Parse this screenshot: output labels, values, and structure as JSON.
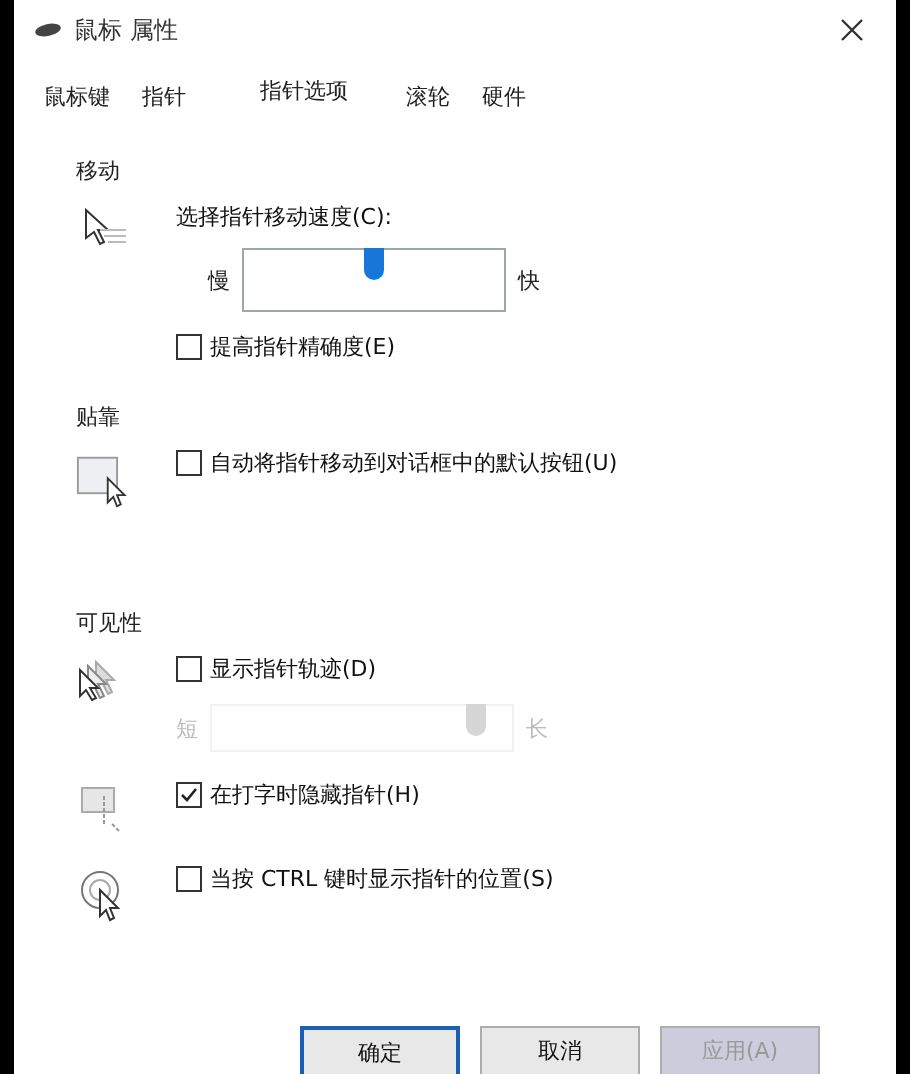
{
  "window": {
    "title": "鼠标 属性"
  },
  "tabs": [
    {
      "label": "鼠标键",
      "selected": false
    },
    {
      "label": "指针",
      "selected": false
    },
    {
      "label": "指针选项",
      "selected": true
    },
    {
      "label": "滚轮",
      "selected": false
    },
    {
      "label": "硬件",
      "selected": false
    }
  ],
  "sections": [
    {
      "heading": "移动",
      "groups": [
        {
          "rows": [
            {
              "kind": "slider",
              "label": "选择指针移动速度(C):",
              "min_label": "慢",
              "max_label": "快",
              "level": 0.5,
              "disabled": false
            },
            {
              "kind": "checkbox",
              "label": "提高指针精确度(E)",
              "checked": false
            }
          ]
        }
      ]
    },
    {
      "heading": "贴靠",
      "groups": [
        {
          "rows": [
            {
              "kind": "checkbox",
              "label": "自动将指针移动到对话框中的默认按钮(U)",
              "checked": false
            }
          ]
        }
      ]
    },
    {
      "heading": "可见性",
      "groups": [
        {
          "rows": [
            {
              "kind": "checkbox",
              "label": "显示指针轨迹(D)",
              "checked": false
            },
            {
              "kind": "slider",
              "min_label": "短",
              "max_label": "长",
              "level": 0.88,
              "disabled": true
            }
          ]
        },
        {
          "rows": [
            {
              "kind": "checkbox",
              "label": "在打字时隐藏指针(H)",
              "checked": true
            }
          ]
        },
        {
          "rows": [
            {
              "kind": "checkbox",
              "label": "当按 CTRL 键时显示指针的位置(S)",
              "checked": false
            }
          ]
        }
      ]
    }
  ],
  "buttons": [
    {
      "label": "确定",
      "default": true,
      "disabled": false
    },
    {
      "label": "取消",
      "default": false,
      "disabled": false
    },
    {
      "label": "应用(A)",
      "default": false,
      "disabled": true
    }
  ]
}
